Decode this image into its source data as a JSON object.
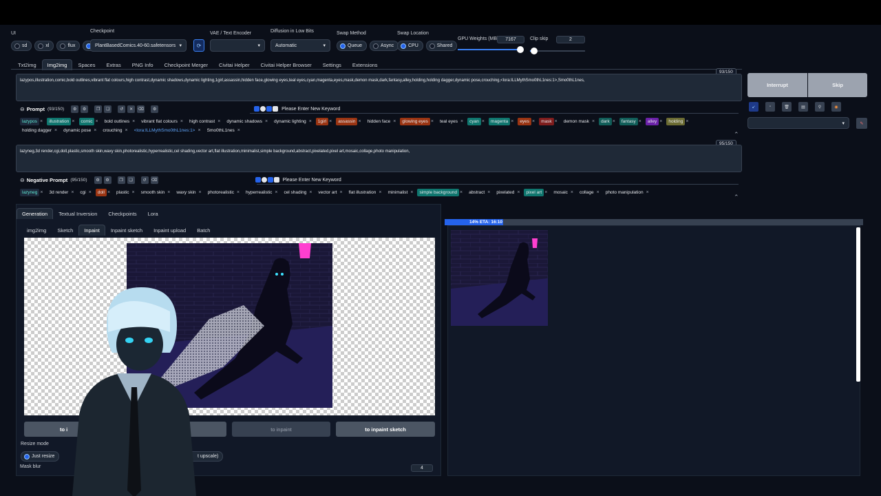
{
  "ui": {
    "label": "UI",
    "options": [
      "sd",
      "xl",
      "flux",
      "all"
    ],
    "selected": "all"
  },
  "checkpoint": {
    "label": "Checkpoint",
    "value": "PlantBasedComics.40-60.safetensors"
  },
  "vae": {
    "label": "VAE / Text Encoder",
    "value": ""
  },
  "diffusion": {
    "label": "Diffusion in Low Bits",
    "value": "Automatic"
  },
  "swap_method": {
    "label": "Swap Method",
    "options": [
      "Queue",
      "Async"
    ],
    "selected": "Queue"
  },
  "swap_location": {
    "label": "Swap Location",
    "options": [
      "CPU",
      "Shared"
    ],
    "selected": "CPU"
  },
  "gpu_weights": {
    "label": "GPU Weights (MB)",
    "value": "7167",
    "fraction": 0.95
  },
  "clip_skip": {
    "label": "Clip skip",
    "value": "2",
    "fraction": 0.08
  },
  "main_tabs": [
    "Txt2img",
    "Img2img",
    "Spaces",
    "Extras",
    "PNG Info",
    "Checkpoint Merger",
    "Civitai Helper",
    "Civitai Helper Browser",
    "Settings",
    "Extensions"
  ],
  "main_tab_active": 1,
  "prompt": {
    "counter": "93/150",
    "text": "lazypos,illustration,comic,bold outlines,vibrant flat colours,high contrast,dynamic shadows,dynamic lighting,1girl,assassin,hidden face,glowing eyes,teal eyes,cyan,magenta,eyes,mask,demon mask,dark,fantasy,alley,holding,holding dagger,dynamic pose,crouching,<lora:ILLMythSmo0thL1nes:1>,Smo0thL1nes,",
    "label": "Prompt",
    "count_label": "(93/150)",
    "keyword_placeholder": "Please Enter New Keyword",
    "tags": [
      {
        "t": "lazypos",
        "c": "#1e293b",
        "f": "#5eead4"
      },
      {
        "t": "illustration",
        "c": "#0f766e",
        "f": "#e5e7eb"
      },
      {
        "t": "comic",
        "c": "#0f766e",
        "f": "#e5e7eb"
      },
      {
        "t": "bold outlines",
        "c": "",
        "f": "#e5e7eb"
      },
      {
        "t": "vibrant flat colours",
        "c": "",
        "f": "#e5e7eb"
      },
      {
        "t": "high contrast",
        "c": "",
        "f": "#e5e7eb"
      },
      {
        "t": "dynamic shadows",
        "c": "",
        "f": "#e5e7eb"
      },
      {
        "t": "dynamic lighting",
        "c": "",
        "f": "#e5e7eb"
      },
      {
        "t": "1girl",
        "c": "#9a3412",
        "f": "#e5e7eb"
      },
      {
        "t": "assassin",
        "c": "#9a3412",
        "f": "#e5e7eb"
      },
      {
        "t": "hidden face",
        "c": "",
        "f": "#e5e7eb"
      },
      {
        "t": "glowing eyes",
        "c": "#9a3412",
        "f": "#e5e7eb"
      },
      {
        "t": "teal eyes",
        "c": "",
        "f": "#e5e7eb"
      },
      {
        "t": "cyan",
        "c": "#0f766e",
        "f": "#e5e7eb"
      },
      {
        "t": "magenta",
        "c": "#0f766e",
        "f": "#e5e7eb"
      },
      {
        "t": "eyes",
        "c": "#9a3412",
        "f": "#e5e7eb"
      },
      {
        "t": "mask",
        "c": "#7f1d1d",
        "f": "#e5e7eb"
      },
      {
        "t": "demon mask",
        "c": "",
        "f": "#e5e7eb"
      },
      {
        "t": "dark",
        "c": "#115e59",
        "f": "#e5e7eb"
      },
      {
        "t": "fantasy",
        "c": "#115e59",
        "f": "#e5e7eb"
      },
      {
        "t": "alley",
        "c": "#6b21a8",
        "f": "#e5e7eb"
      },
      {
        "t": "holding",
        "c": "#6b6b32",
        "f": "#e5e7eb"
      },
      {
        "t": "holding dagger",
        "c": "",
        "f": "#e5e7eb"
      },
      {
        "t": "dynamic pose",
        "c": "",
        "f": "#e5e7eb"
      },
      {
        "t": "crouching",
        "c": "",
        "f": "#e5e7eb"
      },
      {
        "t": "<lora:ILLMythSmo0thL1nes:1>",
        "c": "",
        "f": "#60a5fa"
      },
      {
        "t": "Smo0thL1nes",
        "c": "",
        "f": "#e5e7eb"
      }
    ]
  },
  "negative": {
    "counter": "95/150",
    "text": "lazyneg,3d render,cgi,doll,plastic,smooth skin,waxy skin,photorealistic,hyperrealistic,cel shading,vector art,flat illustration,minimalist,simple background,abstract,pixelated,pixel art,mosaic,collage,photo manipulation,",
    "label": "Negative Prompt",
    "count_label": "(95/150)",
    "keyword_placeholder": "Please Enter New Keyword",
    "tags": [
      {
        "t": "lazyneg",
        "c": "#1e293b",
        "f": "#5eead4"
      },
      {
        "t": "3d render",
        "c": "",
        "f": "#e5e7eb"
      },
      {
        "t": "cgi",
        "c": "",
        "f": "#e5e7eb"
      },
      {
        "t": "doll",
        "c": "#9a3412",
        "f": "#e5e7eb"
      },
      {
        "t": "plastic",
        "c": "",
        "f": "#e5e7eb"
      },
      {
        "t": "smooth skin",
        "c": "",
        "f": "#e5e7eb"
      },
      {
        "t": "waxy skin",
        "c": "",
        "f": "#e5e7eb"
      },
      {
        "t": "photorealistic",
        "c": "",
        "f": "#e5e7eb"
      },
      {
        "t": "hyperrealistic",
        "c": "",
        "f": "#e5e7eb"
      },
      {
        "t": "cel shading",
        "c": "",
        "f": "#e5e7eb"
      },
      {
        "t": "vector art",
        "c": "",
        "f": "#e5e7eb"
      },
      {
        "t": "flat illustration",
        "c": "",
        "f": "#e5e7eb"
      },
      {
        "t": "minimalist",
        "c": "",
        "f": "#e5e7eb"
      },
      {
        "t": "simple background",
        "c": "#0f766e",
        "f": "#e5e7eb"
      },
      {
        "t": "abstract",
        "c": "",
        "f": "#e5e7eb"
      },
      {
        "t": "pixelated",
        "c": "",
        "f": "#e5e7eb"
      },
      {
        "t": "pixel art",
        "c": "#0f766e",
        "f": "#e5e7eb"
      },
      {
        "t": "mosaic",
        "c": "",
        "f": "#e5e7eb"
      },
      {
        "t": "collage",
        "c": "",
        "f": "#e5e7eb"
      },
      {
        "t": "photo manipulation",
        "c": "",
        "f": "#e5e7eb"
      }
    ]
  },
  "actions": {
    "interrupt": "Interrupt",
    "skip": "Skip"
  },
  "sub_tabs": [
    "Generation",
    "Textual Inversion",
    "Checkpoints",
    "Lora"
  ],
  "sub_tab_active": 0,
  "img_tabs": [
    "img2img",
    "Sketch",
    "Inpaint",
    "Inpaint sketch",
    "Inpaint upload",
    "Batch"
  ],
  "img_tab_active": 2,
  "copy_buttons": [
    "to i",
    "to inpaint",
    "to inpaint sketch"
  ],
  "resize": {
    "label": "Resize mode",
    "option": "Just resize",
    "partial_option": "t upscale)"
  },
  "mask_blur": {
    "label": "Mask blur",
    "value": "4"
  },
  "progress": {
    "text": "14% ETA: 16:10",
    "percent": 14
  }
}
